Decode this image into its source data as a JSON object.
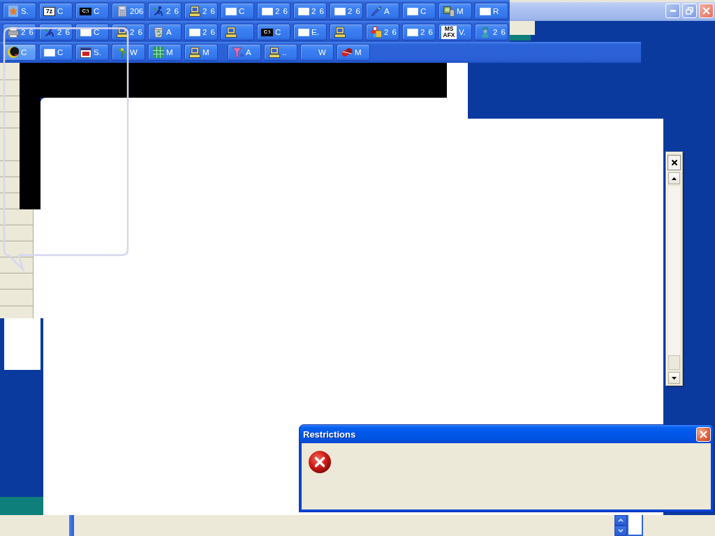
{
  "taskbar_rows": [
    {
      "buttons": [
        {
          "label": "S.",
          "selected": false
        },
        {
          "icon_text": "7z",
          "label": "C",
          "selected": false
        },
        {
          "icon_text": "C:\\",
          "label": "C",
          "selected": false
        },
        {
          "label": "206",
          "selected": false
        },
        {
          "label": "2 6",
          "selected": false
        },
        {
          "label": "2 6",
          "selected": false
        },
        {
          "label": "C",
          "selected": false
        },
        {
          "label": "2 6",
          "selected": false
        },
        {
          "label": "2 6",
          "selected": false
        },
        {
          "label": "2 6",
          "selected": false
        },
        {
          "label": "A",
          "selected": false
        },
        {
          "label": "C",
          "selected": false
        },
        {
          "label": "M",
          "selected": false
        },
        {
          "label": "R",
          "selected": false
        }
      ]
    },
    {
      "buttons": [
        {
          "label": "2 6",
          "selected": false
        },
        {
          "label": "2 6",
          "selected": false
        },
        {
          "label": "C",
          "selected": false
        },
        {
          "label": "2 6",
          "selected": false
        },
        {
          "label": "A",
          "selected": false
        },
        {
          "label": "2 6",
          "selected": false
        },
        {
          "selected": false
        },
        {
          "icon_text": "C:\\",
          "label": "C",
          "selected": false
        },
        {
          "label": "E.",
          "selected": false
        },
        {
          "selected": false
        },
        {
          "label": "2 6",
          "selected": false
        },
        {
          "label": "2 6",
          "selected": false
        },
        {
          "icon_text": "MS AFX",
          "label": "V.",
          "selected": false
        },
        {
          "label": "2 6",
          "selected": false
        }
      ]
    },
    {
      "buttons": [
        {
          "label": "C",
          "selected": true
        },
        {
          "label": "C",
          "selected": false
        },
        {
          "label": "S.",
          "selected": false
        },
        {
          "label": "W",
          "selected": false
        },
        {
          "label": "M",
          "selected": false
        },
        {
          "label": "M",
          "selected": false
        },
        {
          "label": "A",
          "selected": false
        },
        {
          "label": "..",
          "selected": false
        },
        {
          "label": "W",
          "selected": false
        },
        {
          "label": "M",
          "selected": false
        }
      ]
    }
  ],
  "dialog": {
    "title": "Restrictions"
  }
}
